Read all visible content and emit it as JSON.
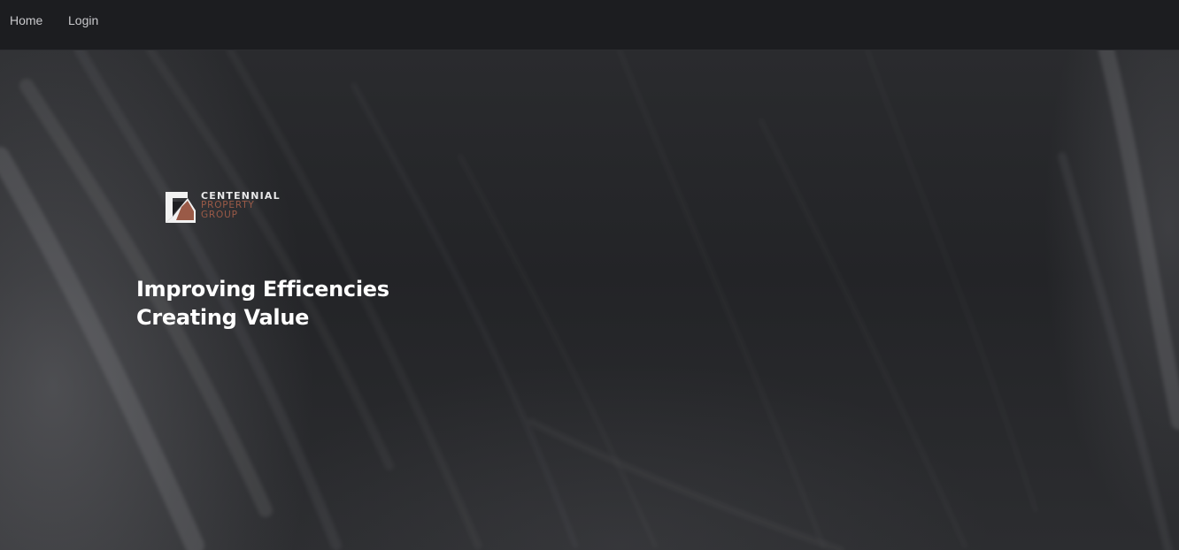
{
  "nav": {
    "items": [
      {
        "label": "Home"
      },
      {
        "label": "Login"
      }
    ]
  },
  "brand": {
    "line1": "CENTENNIAL",
    "line2": "PROPERTY",
    "line3": "GROUP",
    "primary_color": "#e9e9ea",
    "accent_color": "#9a5a47",
    "icon": "logo-mark-icon"
  },
  "hero": {
    "tagline_line1": "Improving Efficencies",
    "tagline_line2": "Creating Value"
  }
}
